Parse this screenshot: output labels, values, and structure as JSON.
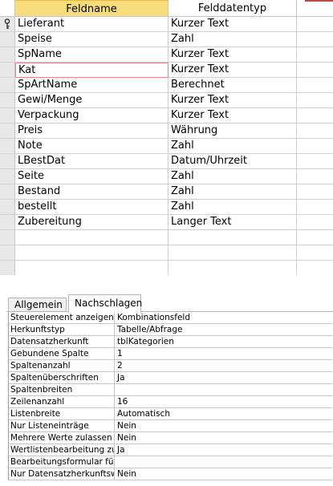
{
  "grid": {
    "header": {
      "field_name": "Feldname",
      "field_type": "Felddatentyp"
    },
    "rows": [
      {
        "name": "Lieferant",
        "type": "Kurzer Text",
        "primary_key": true
      },
      {
        "name": "Speise",
        "type": "Zahl"
      },
      {
        "name": "SpName",
        "type": "Kurzer Text"
      },
      {
        "name": "Kat",
        "type": "Kurzer Text",
        "active": true
      },
      {
        "name": "SpArtName",
        "type": "Berechnet"
      },
      {
        "name": "Gewi/Menge",
        "type": "Kurzer Text"
      },
      {
        "name": "Verpackung",
        "type": "Kurzer Text"
      },
      {
        "name": "Preis",
        "type": "Währung"
      },
      {
        "name": "Note",
        "type": "Zahl"
      },
      {
        "name": "LBestDat",
        "type": "Datum/Uhrzeit"
      },
      {
        "name": "Seite",
        "type": "Zahl"
      },
      {
        "name": "Bestand",
        "type": "Zahl"
      },
      {
        "name": "bestellt",
        "type": "Zahl"
      },
      {
        "name": "Zubereitung",
        "type": "Langer Text"
      },
      {
        "name": "",
        "type": ""
      },
      {
        "name": "",
        "type": ""
      },
      {
        "name": "",
        "type": ""
      }
    ],
    "key_icon": "primary-key-icon"
  },
  "properties": {
    "tabs": [
      {
        "label": "Allgemein",
        "selected": false
      },
      {
        "label": "Nachschlagen",
        "selected": true
      }
    ],
    "rows": [
      {
        "label": "Steuerelement anzeigen",
        "value": "Kombinationsfeld"
      },
      {
        "label": "Herkunftstyp",
        "value": "Tabelle/Abfrage"
      },
      {
        "label": "Datensatzherkunft",
        "value": "tblKategorien"
      },
      {
        "label": "Gebundene Spalte",
        "value": "1"
      },
      {
        "label": "Spaltenanzahl",
        "value": "2"
      },
      {
        "label": "Spaltenüberschriften",
        "value": "Ja"
      },
      {
        "label": "Spaltenbreiten",
        "value": ""
      },
      {
        "label": "Zeilenanzahl",
        "value": "16"
      },
      {
        "label": "Listenbreite",
        "value": "Automatisch"
      },
      {
        "label": "Nur Listeneinträge",
        "value": "Nein"
      },
      {
        "label": "Mehrere Werte zulassen",
        "value": "Nein"
      },
      {
        "label": "Wertlistenbearbeitung zu",
        "value": "Ja"
      },
      {
        "label": "Bearbeitungsformular für",
        "value": ""
      },
      {
        "label": "Nur Datensatzherkunftsw",
        "value": "Nein"
      }
    ]
  }
}
